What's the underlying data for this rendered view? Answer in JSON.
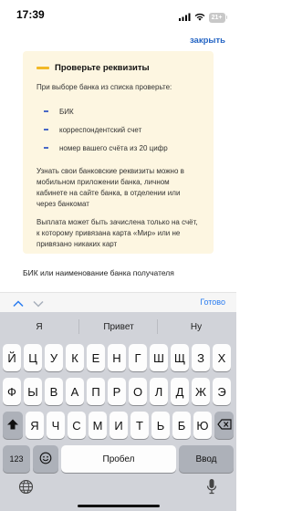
{
  "status_bar": {
    "time": "17:39",
    "battery": "21+"
  },
  "header": {
    "close_label": "закрыть"
  },
  "info_card": {
    "title": "Проверьте реквизиты",
    "intro": "При выборе банка из списка проверьте:",
    "items": [
      "БИК",
      "корреспондентский счет",
      "номер вашего счёта из 20 цифр"
    ],
    "paragraph_1": "Узнать свои банковские реквизиты можно в мобильном приложении банка, личном кабинете на сайте банка, в отделении или через банкомат",
    "paragraph_2": "Выплата может быть зачислена только на счёт, к которому привязана карта «Мир» или не привязано никаких карт"
  },
  "field": {
    "label": "БИК или наименование банка получателя"
  },
  "input_accessory": {
    "done_label": "Готово"
  },
  "keyboard": {
    "suggestions": [
      "Я",
      "Привет",
      "Ну"
    ],
    "row1": [
      "Й",
      "Ц",
      "У",
      "К",
      "Е",
      "Н",
      "Г",
      "Ш",
      "Щ",
      "З",
      "Х"
    ],
    "row2": [
      "Ф",
      "Ы",
      "В",
      "А",
      "П",
      "Р",
      "О",
      "Л",
      "Д",
      "Ж",
      "Э"
    ],
    "row3": [
      "Я",
      "Ч",
      "С",
      "М",
      "И",
      "Т",
      "Ь",
      "Б",
      "Ю"
    ],
    "numbers_label": "123",
    "space_label": "Пробел",
    "enter_label": "Ввод"
  },
  "colors": {
    "accent": "#2565c4",
    "card_bg": "#fdf6e1",
    "card_marker": "#f2b826",
    "bullet": "#4a69c6"
  }
}
